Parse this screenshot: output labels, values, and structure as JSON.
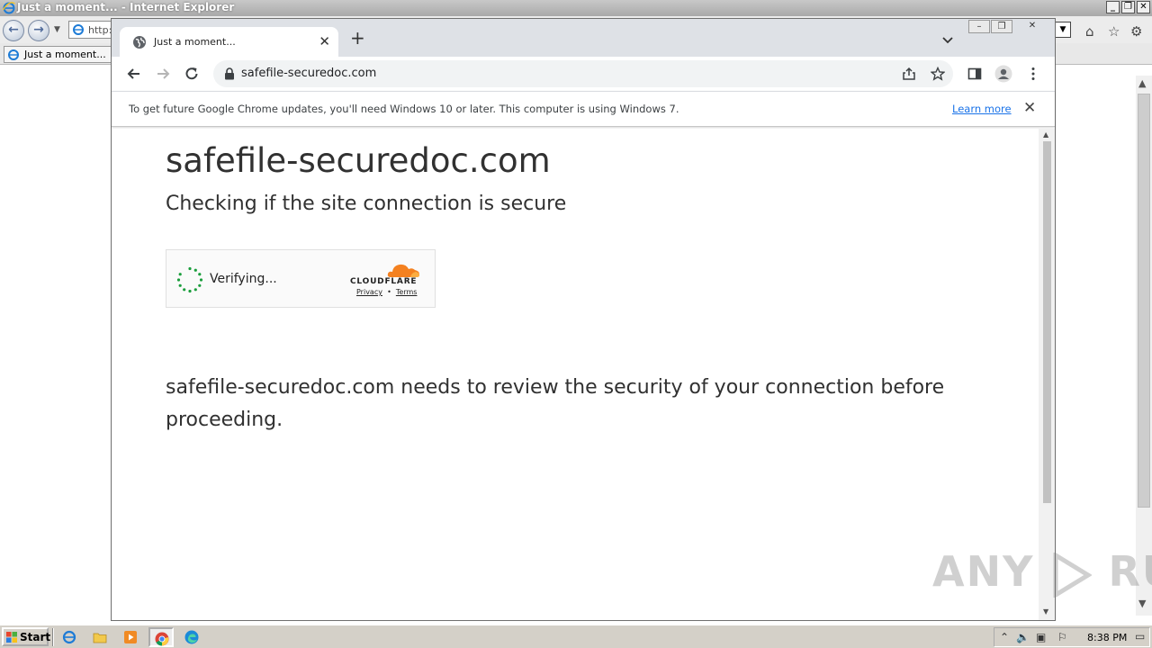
{
  "ie": {
    "title": "Just a moment... - Internet Explorer",
    "address_text": "http://",
    "tab_label": "Just a moment..."
  },
  "chrome": {
    "tab_title": "Just a moment...",
    "url": "safefile-securedoc.com",
    "infobar_message": "To get future Google Chrome updates, you'll need Windows 10 or later. This computer is using Windows 7.",
    "infobar_link": "Learn more"
  },
  "page": {
    "title": "safefile-securedoc.com",
    "subtitle": "Checking if the site connection is secure",
    "verifying": "Verifying...",
    "brand": "CLOUDFLARE",
    "privacy": "Privacy",
    "separator": "•",
    "terms": "Terms",
    "review_message": "safefile-securedoc.com needs to review the security of your connection before proceeding."
  },
  "watermark": {
    "left": "ANY",
    "right": "RUN"
  },
  "taskbar": {
    "start_label": "Start",
    "clock": "8:38 PM"
  },
  "colors": {
    "chrome_tabstrip": "#dee1e6",
    "link_blue": "#1a73e8",
    "cloudflare_orange": "#f48120",
    "spinner_green": "#1a9e3c"
  }
}
